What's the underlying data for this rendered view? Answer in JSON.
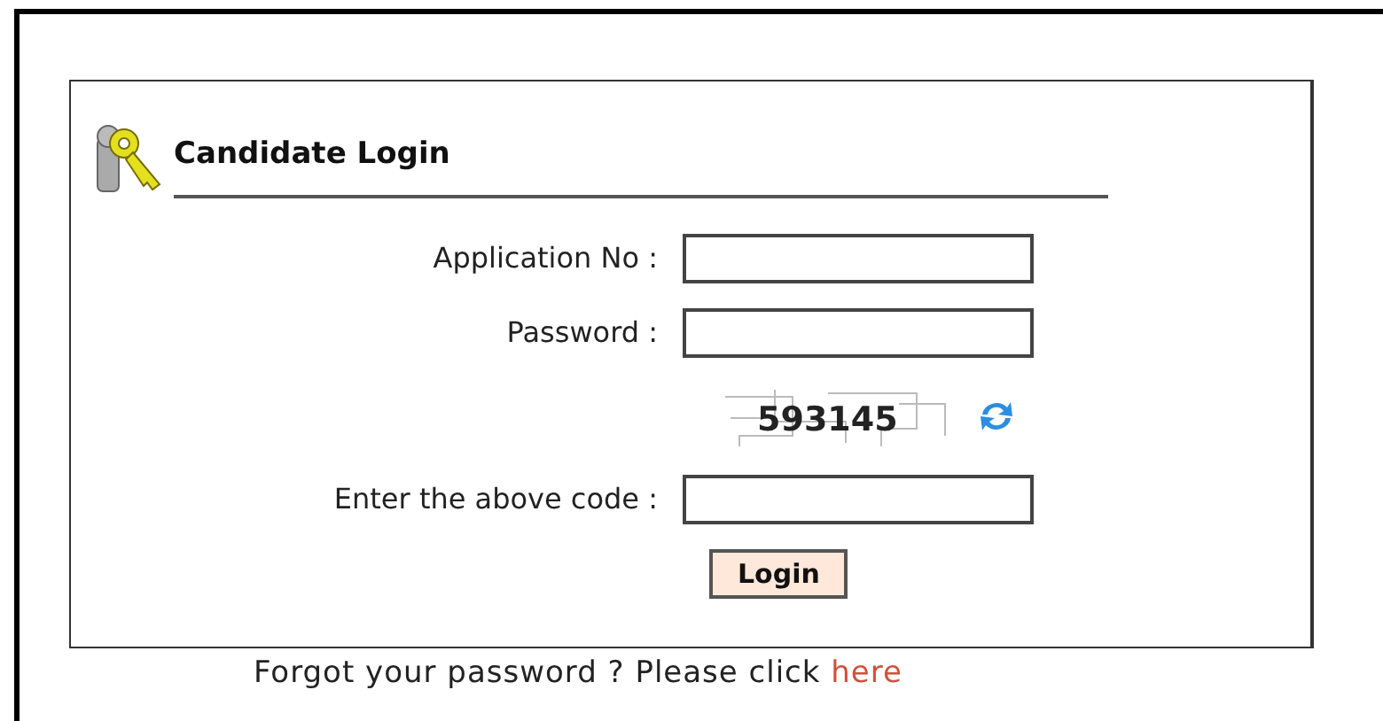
{
  "panel": {
    "title": "Candidate Login"
  },
  "fields": [
    {
      "kind": "input",
      "label": "Application No :"
    },
    {
      "kind": "input",
      "label": "Password :"
    },
    {
      "kind": "captcha",
      "code": "593145"
    },
    {
      "kind": "input",
      "label": "Enter the above code :"
    }
  ],
  "login_button": "Login",
  "footer": {
    "text": "Forgot your password ? Please click",
    "link": "here"
  }
}
